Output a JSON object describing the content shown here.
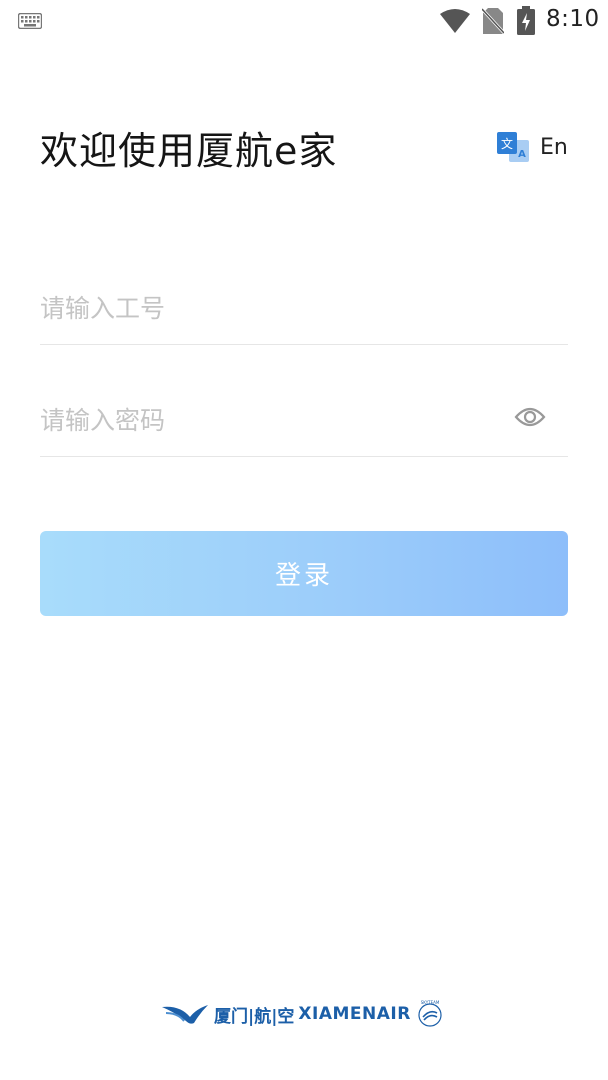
{
  "status_bar": {
    "time": "8:10",
    "icons": [
      "keyboard-icon",
      "wifi-icon",
      "no-sim-icon",
      "battery-charging-icon"
    ]
  },
  "header": {
    "title": "欢迎使用厦航e家",
    "language_toggle": {
      "icon": "translate-icon",
      "label": "En"
    }
  },
  "login_form": {
    "employee_id": {
      "value": "",
      "placeholder": "请输入工号"
    },
    "password": {
      "value": "",
      "placeholder": "请输入密码",
      "visibility_icon": "eye-icon"
    },
    "submit_label": "登录"
  },
  "footer": {
    "brand_cn": "厦门|航|空",
    "brand_en": "XIAMENAIR",
    "brand_seal_text": "SKYTEAM"
  },
  "colors": {
    "brand_blue": "#1c5fa8",
    "button_gradient_start": "#a8dcfb",
    "button_gradient_end": "#8dbefa",
    "placeholder": "#c4c4c4"
  }
}
